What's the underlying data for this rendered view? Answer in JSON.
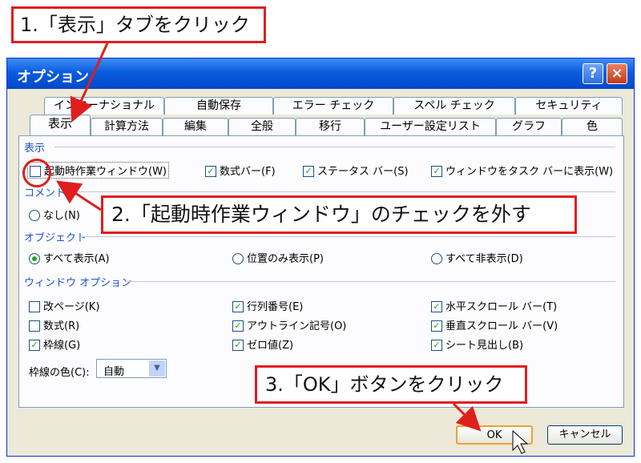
{
  "dialog": {
    "title": "オプション",
    "help_icon": "?",
    "close_icon": "×"
  },
  "tabs": {
    "row1": [
      "インターナショナル",
      "自動保存",
      "エラー チェック",
      "スペル チェック",
      "セキュリティ"
    ],
    "row2": [
      "表示",
      "計算方法",
      "編集",
      "全般",
      "移行",
      "ユーザー設定リスト",
      "グラフ",
      "色"
    ],
    "active": "表示"
  },
  "groups": {
    "display": "表示",
    "comment": "コメント",
    "object": "オブジェクト",
    "window_options": "ウィンドウ オプション"
  },
  "display_items": [
    {
      "label": "起動時作業ウィンドウ(W)",
      "checked": false
    },
    {
      "label": "数式バー(F)",
      "checked": true
    },
    {
      "label": "ステータス バー(S)",
      "checked": true
    },
    {
      "label": "ウィンドウをタスク バーに表示(W)",
      "checked": true
    }
  ],
  "comment_items": [
    {
      "label": "なし(N)",
      "checked": false
    }
  ],
  "object_items": [
    {
      "label": "すべて表示(A)",
      "checked": true
    },
    {
      "label": "位置のみ表示(P)",
      "checked": false
    },
    {
      "label": "すべて非表示(D)",
      "checked": false
    }
  ],
  "window_items": [
    {
      "label": "改ページ(K)",
      "checked": false
    },
    {
      "label": "数式(R)",
      "checked": false
    },
    {
      "label": "枠線(G)",
      "checked": true
    },
    {
      "label": "行列番号(E)",
      "checked": true
    },
    {
      "label": "アウトライン記号(O)",
      "checked": true
    },
    {
      "label": "ゼロ値(Z)",
      "checked": true
    },
    {
      "label": "水平スクロール バー(T)",
      "checked": true
    },
    {
      "label": "垂直スクロール バー(V)",
      "checked": true
    },
    {
      "label": "シート見出し(B)",
      "checked": true
    }
  ],
  "gridline_color": {
    "label": "枠線の色(C):",
    "value": "自動"
  },
  "buttons": {
    "ok": "OK",
    "cancel": "キャンセル"
  },
  "callouts": {
    "step1": "1.「表示」タブをクリック",
    "step2": "2.「起動時作業ウィンドウ」のチェックを外す",
    "step3": "3.「OK」ボタンをクリック"
  },
  "colors": {
    "callout_red": "#e01e1e",
    "title_blue": "#0a5ddf",
    "group_title": "#1e53cc",
    "check_green": "#21a121"
  }
}
